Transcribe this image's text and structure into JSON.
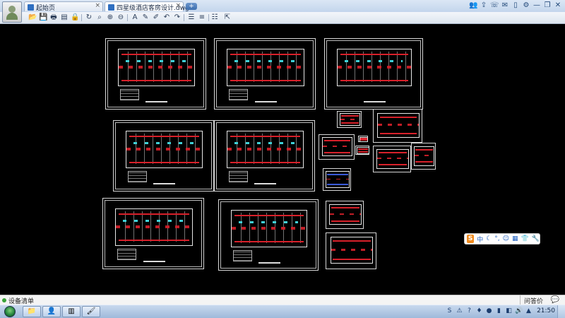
{
  "tabs": [
    {
      "label": "起始页",
      "close": "×"
    },
    {
      "label": "四星级酒店客房设计.dwg",
      "close": "×"
    }
  ],
  "new_tab_label": "+",
  "title_icons": [
    "user-icon",
    "share-icon",
    "phone-icon",
    "message-icon",
    "mobile-icon",
    "settings-icon",
    "minimize-icon",
    "restore-icon",
    "close-icon"
  ],
  "title_icon_glyphs": [
    "👥",
    "⇪",
    "☏",
    "✉",
    "▯",
    "⚙",
    "—",
    "❐",
    "✕"
  ],
  "toolbar": {
    "icons": [
      "open-file-icon",
      "save-icon",
      "print-icon",
      "pdf-icon",
      "lock-icon",
      "rotate-icon",
      "zoom-window-icon",
      "zoom-in-icon",
      "zoom-out-icon",
      "pan-icon",
      "text-icon",
      "pencil-icon",
      "marker-icon",
      "undo-icon",
      "redo-icon",
      "layer-icon",
      "layer-color-icon",
      "measure-icon",
      "layers-stack-icon",
      "export-icon"
    ],
    "glyphs": [
      "📂",
      "💾",
      "🖶",
      "▤",
      "🔒",
      "↻",
      "⌕",
      "⊕",
      "⊖",
      "✥",
      "A",
      "✎",
      "✐",
      "↶",
      "↷",
      "☰",
      "≡",
      "⟷",
      "☷",
      "⇱"
    ]
  },
  "ime_bar": {
    "s": "S",
    "items": [
      "中",
      "☾",
      "°,",
      "☺",
      "▦",
      "👕",
      "🔧"
    ]
  },
  "status": {
    "text": "设备清单",
    "right": "问答价",
    "chat_icon": "💬"
  },
  "taskbar": {
    "buttons": [
      "📁",
      "👤",
      "▥",
      "🖌"
    ],
    "tray_glyphs": [
      "S",
      "⚠",
      "?",
      "♦",
      "●",
      "▮",
      "◧",
      "🔊",
      "▲"
    ],
    "clock": "21:50"
  }
}
